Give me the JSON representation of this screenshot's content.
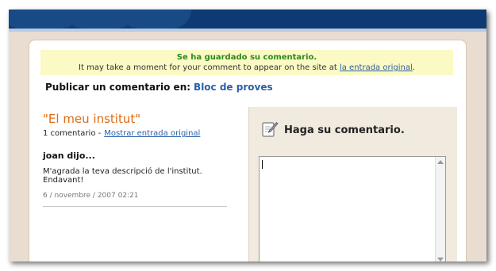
{
  "notice": {
    "saved": "Se ha guardado su comentario.",
    "line2_prefix": "It may take a moment for your comment to appear on the site at ",
    "link": "la entrada original",
    "line2_suffix": "."
  },
  "publish": {
    "label": "Publicar un comentario en:",
    "blog": "Bloc de proves"
  },
  "post": {
    "title": "\"El meu institut\"",
    "count": "1 comentario -",
    "show_link": "Mostrar entrada original"
  },
  "comment": {
    "author": "joan dijo...",
    "text": "M'agrada la teva descripció de l'institut. Endavant!",
    "date": "6 / novembre / 2007 02:21"
  },
  "form": {
    "title": "Haga su comentario.",
    "value": ""
  },
  "colors": {
    "topbar": "#0e3a73",
    "title_orange": "#e06a12",
    "link_blue": "#2a5fa8",
    "saved_green": "#2b8a1e",
    "notice_bg": "#fbf9c4"
  }
}
